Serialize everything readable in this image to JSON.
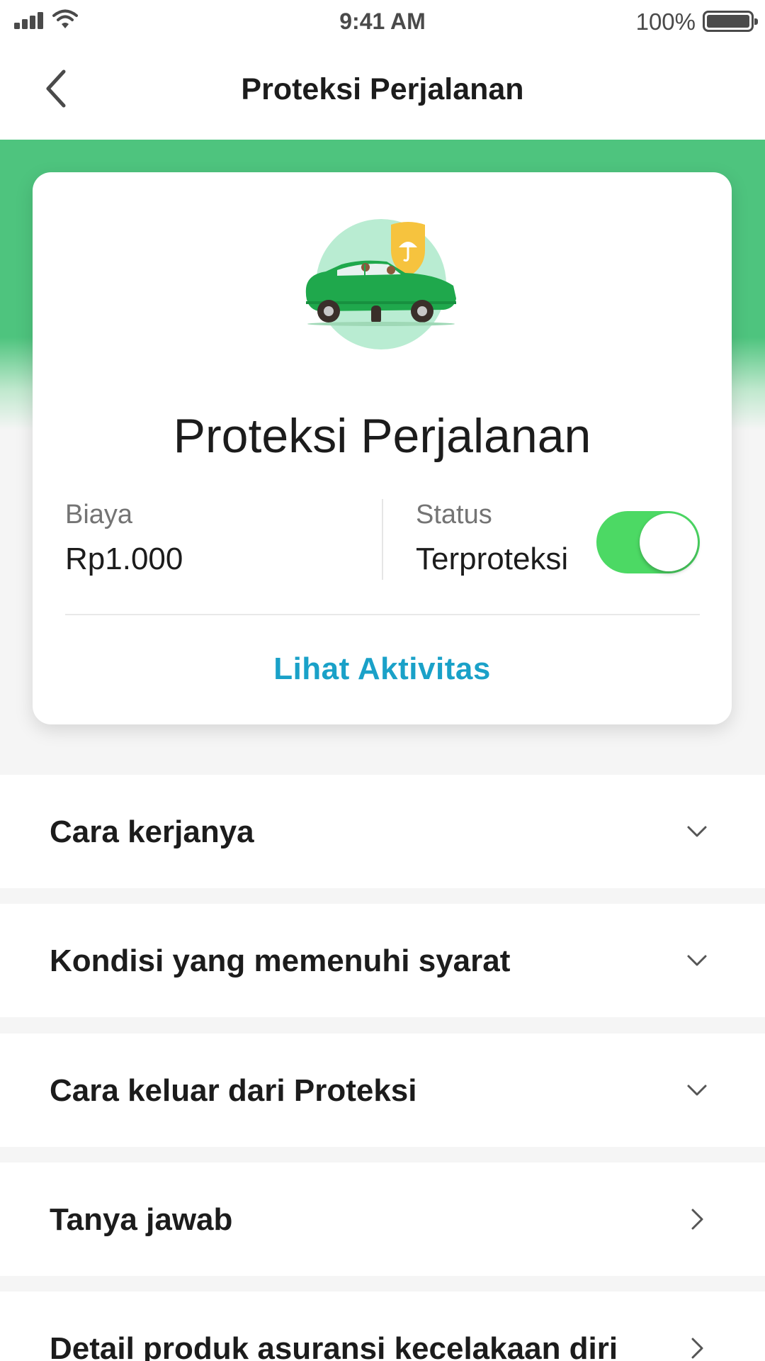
{
  "status_bar": {
    "time": "9:41 AM",
    "battery_percent": "100%"
  },
  "app_bar": {
    "back_icon": "chevron-left-icon",
    "title": "Proteksi Perjalanan"
  },
  "colors": {
    "brand_green": "#4ec47e",
    "toggle_on": "#4cd964",
    "link": "#1aa1c8"
  },
  "card": {
    "illustration": "car-with-umbrella-shield-illustration",
    "title": "Proteksi Perjalanan",
    "cost_label": "Biaya",
    "cost_value": "Rp1.000",
    "status_label": "Status",
    "status_value": "Terproteksi",
    "toggle_on": true,
    "link": "Lihat Aktivitas"
  },
  "sections": [
    {
      "label": "Cara kerjanya",
      "icon": "chevron-down-icon"
    },
    {
      "label": "Kondisi yang memenuhi syarat",
      "icon": "chevron-down-icon"
    },
    {
      "label": "Cara keluar dari Proteksi",
      "icon": "chevron-down-icon"
    },
    {
      "label": "Tanya jawab",
      "icon": "chevron-right-icon"
    },
    {
      "label": "Detail produk asuransi kecelakaan diri",
      "icon": "chevron-right-icon"
    }
  ]
}
